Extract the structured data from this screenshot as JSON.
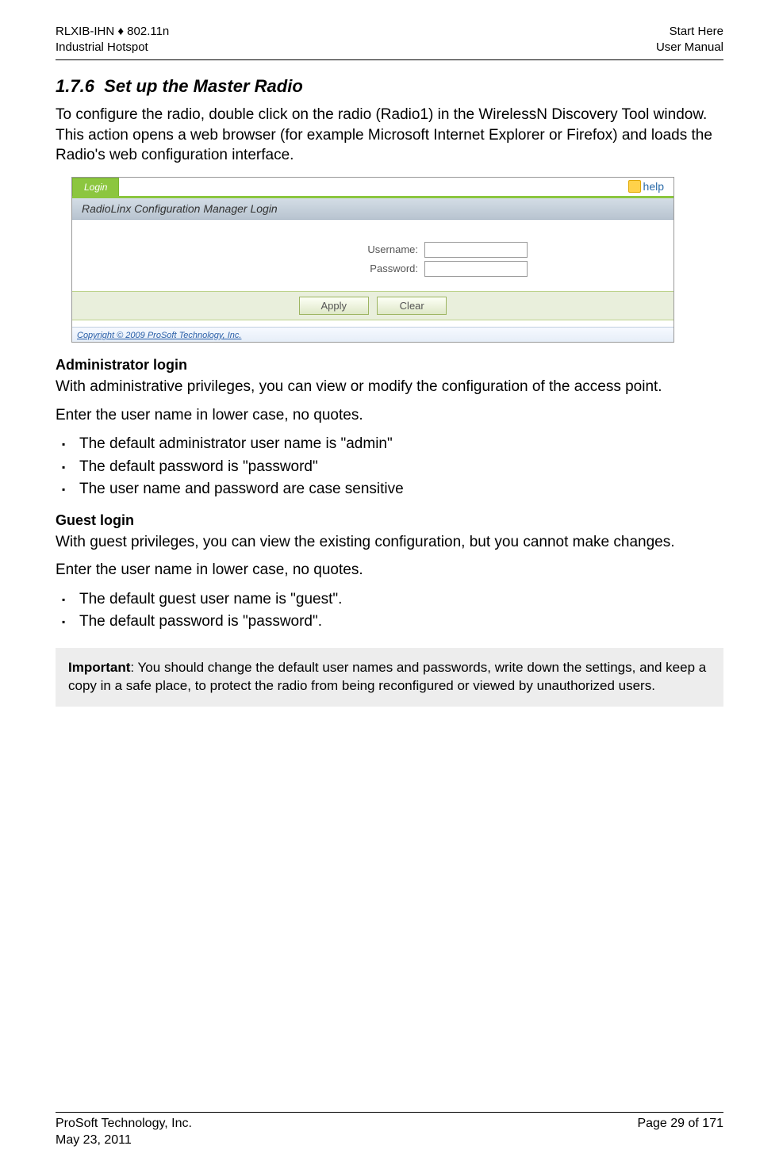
{
  "header": {
    "left_line1": "RLXIB-IHN ♦ 802.11n",
    "left_line2": "Industrial Hotspot",
    "right_line1": "Start Here",
    "right_line2": "User Manual"
  },
  "section": {
    "number": "1.7.6",
    "title": "Set up the Master Radio",
    "intro": "To configure the radio, double click on the radio (Radio1) in the WirelessN Discovery Tool window. This action opens a web browser (for example Microsoft Internet Explorer or Firefox) and loads the Radio's web configuration interface."
  },
  "screenshot": {
    "tab_label": "Login",
    "help_label": "help",
    "bar_title": "RadioLinx Configuration Manager Login",
    "username_label": "Username:",
    "password_label": "Password:",
    "apply_label": "Apply",
    "clear_label": "Clear",
    "copyright": "Copyright © 2009 ProSoft Technology, Inc."
  },
  "admin": {
    "heading": "Administrator login",
    "p1": "With administrative privileges, you can view or modify the configuration of the access point.",
    "p2": "Enter the user name in lower case, no quotes.",
    "bullets": [
      "The default administrator user name is \"admin\"",
      "The default password is \"password\"",
      "The user name and password are case sensitive"
    ]
  },
  "guest": {
    "heading": "Guest login",
    "p1": "With guest privileges, you can view the existing configuration, but you cannot make changes.",
    "p2": "Enter the user name in lower case, no quotes.",
    "bullets": [
      "The default guest user name is \"guest\".",
      "The default password is \"password\"."
    ]
  },
  "note": {
    "label": "Important",
    "text": ": You should change the default user names and passwords, write down the settings, and keep a copy in a safe place, to protect the radio from being reconfigured or viewed by unauthorized users."
  },
  "footer": {
    "left_line1": "ProSoft Technology, Inc.",
    "left_line2": "May 23, 2011",
    "right_line1": "Page 29 of 171"
  }
}
